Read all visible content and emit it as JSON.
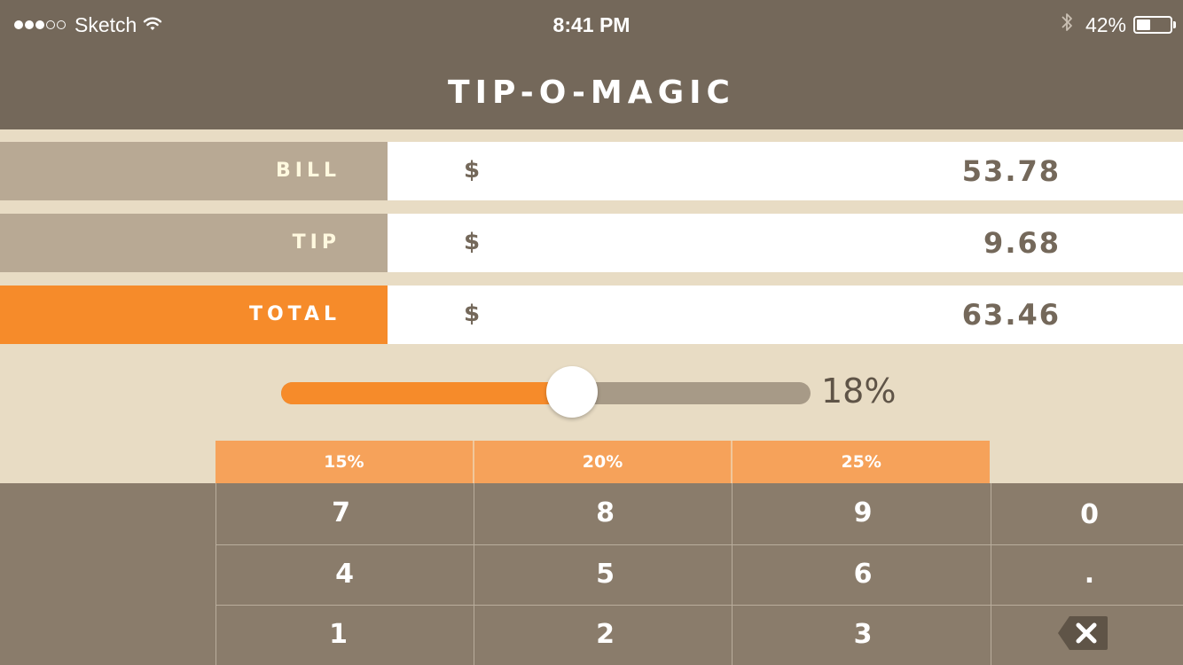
{
  "status_bar": {
    "carrier": "Sketch",
    "time": "8:41 PM",
    "battery_percent": "42%",
    "battery_level": 0.42,
    "signal_dots_filled": 3,
    "signal_dots_total": 5
  },
  "header": {
    "title": "TIP-O-MAGIC"
  },
  "rows": [
    {
      "label": "BILL",
      "currency": "$",
      "amount": "53.78"
    },
    {
      "label": "TIP",
      "currency": "$",
      "amount": "9.68"
    },
    {
      "label": "TOTAL",
      "currency": "$",
      "amount": "63.46"
    }
  ],
  "slider": {
    "value_label": "18%",
    "fraction": 0.55
  },
  "presets": [
    "15%",
    "20%",
    "25%"
  ],
  "keypad": {
    "rows": [
      [
        "7",
        "8",
        "9",
        "0"
      ],
      [
        "4",
        "5",
        "6",
        "."
      ],
      [
        "1",
        "2",
        "3",
        ""
      ]
    ],
    "backspace_icon": "backspace-icon"
  },
  "colors": {
    "header_bg": "#74685a",
    "accent": "#f68b2a",
    "preset_bg": "#f6a25a",
    "keypad_bg": "#8a7c6b",
    "page_bg": "#e8dcc4"
  }
}
